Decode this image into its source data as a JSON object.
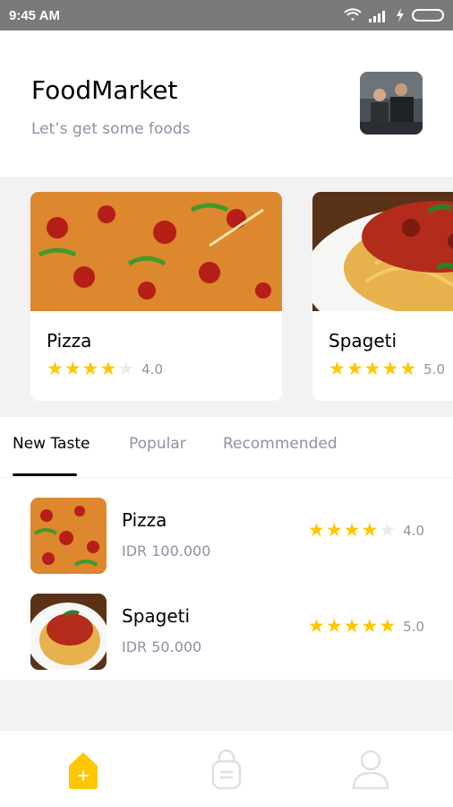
{
  "status_bar": {
    "time": "9:45 AM"
  },
  "header": {
    "title": "FoodMarket",
    "subtitle": "Let’s get some foods"
  },
  "cards": [
    {
      "name": "Pizza",
      "rating": 4.0,
      "rating_text": "4.0",
      "stars": 4
    },
    {
      "name": "Spageti",
      "rating": 5.0,
      "rating_text": "5.0",
      "stars": 5
    }
  ],
  "tabs": [
    {
      "label": "New Taste",
      "active": true
    },
    {
      "label": "Popular",
      "active": false
    },
    {
      "label": "Recommended",
      "active": false
    }
  ],
  "list": [
    {
      "name": "Pizza",
      "price": "IDR 100.000",
      "rating_text": "4.0",
      "stars": 4
    },
    {
      "name": "Spageti",
      "price": "IDR 50.000",
      "rating_text": "5.0",
      "stars": 5
    }
  ],
  "nav": [
    {
      "icon": "home-icon",
      "active": true
    },
    {
      "icon": "bag-icon",
      "active": false
    },
    {
      "icon": "profile-icon",
      "active": false
    }
  ],
  "colors": {
    "accent": "#FFC700",
    "muted": "#8D92A3",
    "text": "#020202",
    "bg": "#F2F2F2"
  }
}
